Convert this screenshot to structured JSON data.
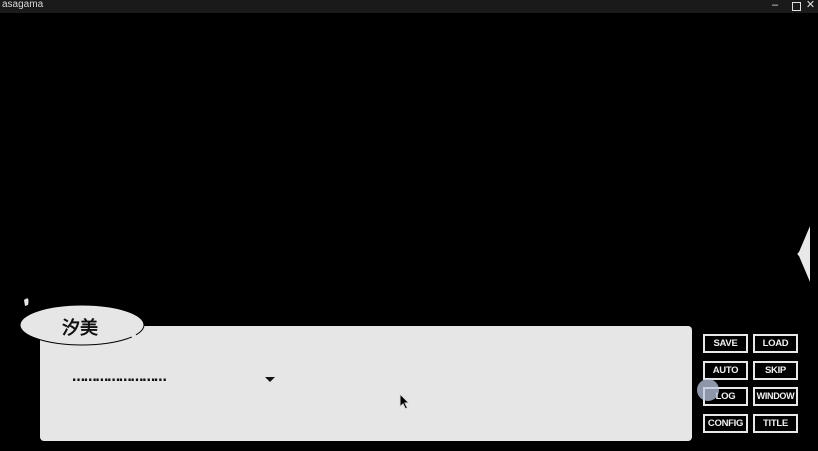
{
  "window": {
    "title": "asagama",
    "controls": {
      "minimize": "–",
      "close": "✕"
    }
  },
  "nameplate": {
    "speaker": "汐美"
  },
  "dialogue": {
    "text": "……………………"
  },
  "menu": {
    "save": "SAVE",
    "load": "LOAD",
    "auto": "AUTO",
    "skip": "SKIP",
    "log": "LOG",
    "window": "WINDOW",
    "config": "CONFIG",
    "title": "TITLE"
  },
  "colors": {
    "background": "#000000",
    "dialog_box": "#e6e6e6",
    "button_border": "#e8e8e8"
  }
}
